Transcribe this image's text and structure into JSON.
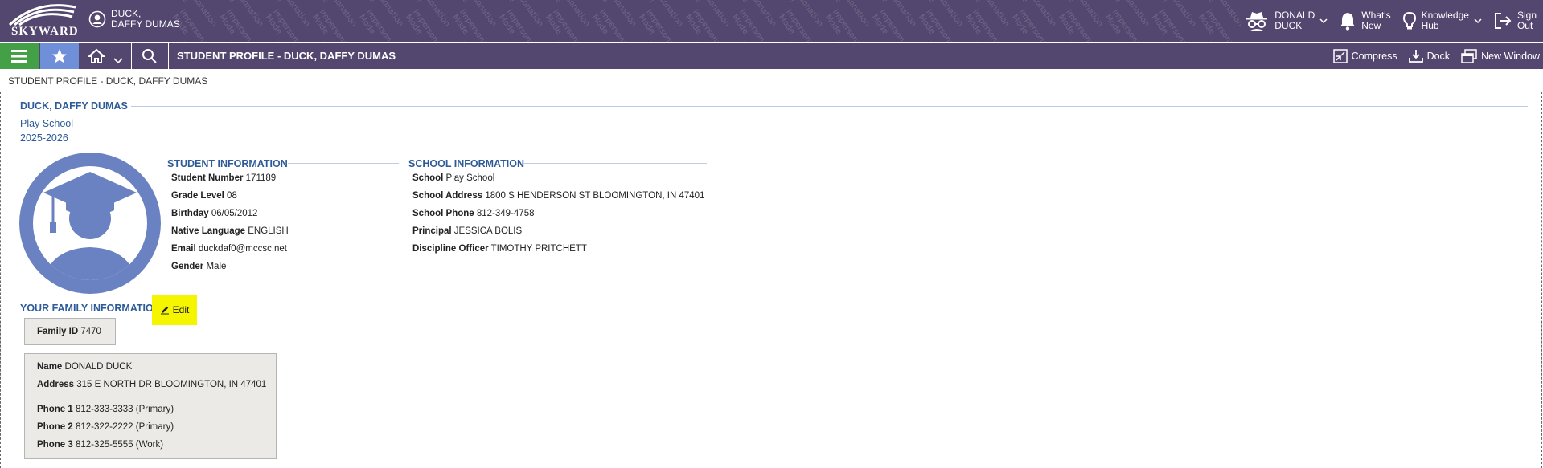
{
  "header": {
    "logo_text": "SKYWARD",
    "watermark_text": "Impersonation Mode",
    "student_switch": {
      "line1": "DUCK,",
      "line2": "DAFFY DUMAS"
    },
    "user": {
      "line1": "DONALD",
      "line2": "DUCK"
    },
    "whats_new": {
      "line1": "What's",
      "line2": "New"
    },
    "knowledge_hub": {
      "line1": "Knowledge",
      "line2": "Hub"
    },
    "sign_out": {
      "line1": "Sign",
      "line2": "Out"
    }
  },
  "navbar": {
    "page_title": "STUDENT PROFILE - DUCK, DAFFY DUMAS",
    "actions": {
      "compress": "Compress",
      "dock": "Dock",
      "new_window": "New Window"
    }
  },
  "breadcrumb": "STUDENT PROFILE - DUCK, DAFFY DUMAS",
  "student": {
    "name": "DUCK, DAFFY DUMAS",
    "school": "Play School",
    "year": "2025-2026"
  },
  "student_information": {
    "heading": "STUDENT INFORMATION",
    "fields": [
      {
        "label": "Student Number",
        "value": "171189"
      },
      {
        "label": "Grade Level",
        "value": "08"
      },
      {
        "label": "Birthday",
        "value": "06/05/2012"
      },
      {
        "label": "Native Language",
        "value": "ENGLISH"
      },
      {
        "label": "Email",
        "value": "duckdaf0@mccsc.net"
      },
      {
        "label": "Gender",
        "value": "Male"
      }
    ]
  },
  "school_information": {
    "heading": "SCHOOL INFORMATION",
    "fields": [
      {
        "label": "School",
        "value": "Play School"
      },
      {
        "label": "School Address",
        "value": "1800 S HENDERSON ST BLOOMINGTON, IN 47401"
      },
      {
        "label": "School Phone",
        "value": "812-349-4758"
      },
      {
        "label": "Principal",
        "value": "JESSICA BOLIS"
      },
      {
        "label": "Discipline Officer",
        "value": "TIMOTHY PRITCHETT"
      }
    ]
  },
  "family": {
    "heading": "YOUR FAMILY INFORMATION",
    "edit_label": "Edit",
    "family_id": {
      "label": "Family ID",
      "value": "7470"
    },
    "guardian": {
      "name": {
        "label": "Name",
        "value": "DONALD DUCK"
      },
      "address": {
        "label": "Address",
        "value": "315 E NORTH DR BLOOMINGTON, IN 47401"
      },
      "phones": [
        {
          "label": "Phone 1",
          "value": "812-333-3333 (Primary)"
        },
        {
          "label": "Phone 2",
          "value": "812-322-2222 (Primary)"
        },
        {
          "label": "Phone 3",
          "value": "812-325-5555 (Work)"
        }
      ]
    }
  },
  "colors": {
    "banner": "#54476f",
    "menu_green": "#43a047",
    "favorites_blue": "#6f8fd8",
    "heading_blue": "#2d5a98",
    "avatar_blue": "#6a82c2",
    "highlight_yellow": "#f5f500"
  },
  "icons": [
    "skyward-logo-icon",
    "student-avatar-icon",
    "incognito-user-icon",
    "bell-icon",
    "lightbulb-icon",
    "sign-out-icon",
    "hamburger-menu-icon",
    "star-icon",
    "home-icon",
    "chevron-down-icon",
    "search-icon",
    "compress-icon",
    "dock-icon",
    "new-window-icon",
    "graduate-avatar-icon",
    "pencil-icon"
  ]
}
